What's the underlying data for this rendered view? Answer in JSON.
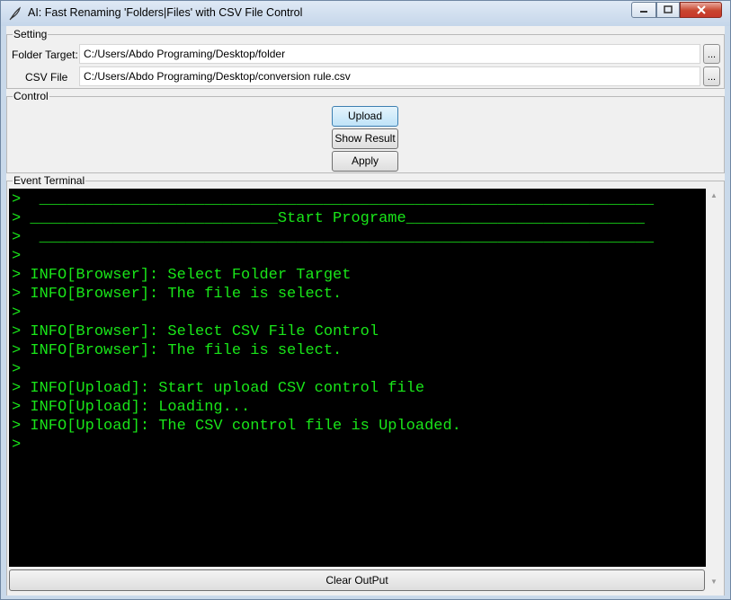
{
  "window": {
    "title": "AI: Fast Renaming 'Folders|Files' with CSV File Control",
    "icons": {
      "app": "feather-icon",
      "minimize": "minimize-icon",
      "maximize": "maximize-icon",
      "close": "close-icon"
    }
  },
  "setting": {
    "label": "Setting",
    "folder_target": {
      "label": "Folder Target:",
      "value": "C:/Users/Abdo Programing/Desktop/folder",
      "browse_label": "..."
    },
    "csv_file": {
      "label": "CSV File",
      "value": "C:/Users/Abdo Programing/Desktop/conversion rule.csv",
      "browse_label": "..."
    }
  },
  "control": {
    "label": "Control",
    "upload_label": "Upload",
    "show_result_label": "Show Result",
    "apply_label": "Apply"
  },
  "terminal": {
    "label": "Event Terminal",
    "lines": [
      ">  ___________________________________________________________________",
      "> ___________________________Start Programe__________________________",
      ">  ___________________________________________________________________",
      ">",
      "> INFO[Browser]: Select Folder Target",
      "> INFO[Browser]: The file is select.",
      ">",
      "> INFO[Browser]: Select CSV File Control",
      "> INFO[Browser]: The file is select.",
      ">",
      "> INFO[Upload]: Start upload CSV control file",
      "> INFO[Upload]: Loading...",
      "> INFO[Upload]: The CSV control file is Uploaded.",
      ">"
    ],
    "clear_label": "Clear OutPut",
    "colors": {
      "background": "#000000",
      "text": "#19e619"
    }
  }
}
